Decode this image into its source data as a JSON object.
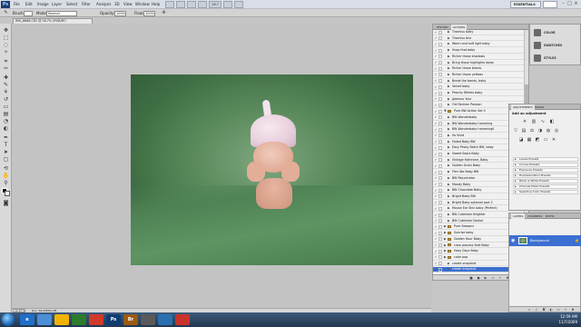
{
  "menubar": {
    "logo": "Ps",
    "items": [
      "File",
      "Edit",
      "Image",
      "Layer",
      "Select",
      "Filter",
      "Analysis",
      "3D",
      "View",
      "Window",
      "Help"
    ],
    "zoom": "16.7",
    "workspace": "ESSENTIALS"
  },
  "options": {
    "brush_label": "Brush:",
    "mode_label": "Mode:",
    "mode_value": "Normal",
    "opacity_label": "Opacity:",
    "opacity_value": "100%",
    "flow_label": "Flow:",
    "flow_value": "100%"
  },
  "document": {
    "tab_title": "IMG_6686.CR2 @ 16.7% (RGB/8*)",
    "zoom_status": "16.67%",
    "doc_size": "Doc: 60.2M/60.2M"
  },
  "actions": {
    "tabs": [
      "HISTORY",
      "ACTIONS"
    ],
    "items": [
      "Tiramisu baby",
      "Tiramisu blur",
      "Warm and soft light baby",
      "Snap that baby",
      "Richer those shadows",
      "Bring those highlights down",
      "Richer those blacks",
      "Richer those yellows",
      "Break the bands, baby",
      "Velvet baby",
      "Peachy Whites baby",
      "glamour blur",
      "Old Fashion Passion",
      "Pure BW Action Set II",
      "BW Wonderbaby",
      "BW Wonderbaby+warming",
      "BW Wonderbaby+warmingII",
      "So Vivid",
      "Faded Baby BW",
      "Easy Peasy Batch BW, baby",
      "Sweet Sepia Baby",
      "Vintage Hathrone, Baby",
      "Golden Grain Baby",
      "Film like Baby BW",
      "BW Rejuvinator",
      "Moody Baby",
      "BW Chocolate Baby",
      "Bright Baby BW",
      "Bright Baby optional part 2",
      "Mouse Ear Skin baby (Perfect)",
      "BW Cuteinker Brighter",
      "BW Cuteinker Darker",
      "Pure Seasons",
      "Sunrise baby",
      "Golden Hour Baby",
      "crow process that Baby",
      "Hazy Days Baby",
      "color pop",
      "create snapshot",
      "create snapshot"
    ]
  },
  "side_strip": {
    "buttons": [
      "COLOR",
      "SWATCHES",
      "STYLES"
    ]
  },
  "adjustments": {
    "tabs": [
      "ADJUSTMENTS",
      "MASKS"
    ],
    "title": "Add an adjustment",
    "presets": [
      "Levels Presets",
      "Curves Presets",
      "Exposure Presets",
      "Hue/Saturation Presets",
      "Black & White Presets",
      "Channel Mixer Presets",
      "Selective Color Presets"
    ]
  },
  "layers": {
    "tabs": [
      "LAYERS",
      "CHANNELS",
      "PATHS"
    ],
    "layer_name": "Background"
  },
  "taskbar": {
    "apps": [
      {
        "label": "e",
        "color": "#1f6fc9"
      },
      {
        "label": "",
        "color": "#4a8fd8"
      },
      {
        "label": "",
        "color": "#f0b400"
      },
      {
        "label": "",
        "color": "#2d7c2d"
      },
      {
        "label": "",
        "color": "#d03a2a"
      },
      {
        "label": "Ps",
        "color": "#0f3c70"
      },
      {
        "label": "Br",
        "color": "#9c5a12"
      },
      {
        "label": "",
        "color": "#5a5a5a"
      },
      {
        "label": "",
        "color": "#2a6fb0"
      },
      {
        "label": "",
        "color": "#c8332b"
      }
    ],
    "time": "12:59 AM",
    "date": "11/7/2009"
  }
}
